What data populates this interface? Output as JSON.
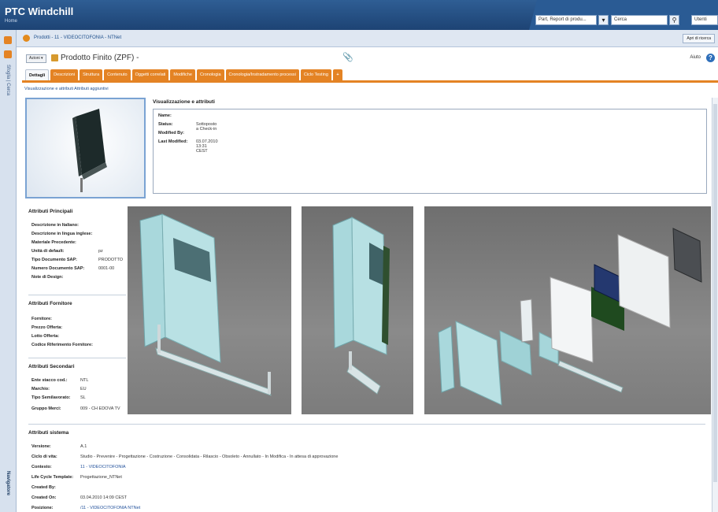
{
  "header": {
    "brand": "PTC Windchill",
    "brand_sub": "Home",
    "search_scope": "Part, Report di produ...",
    "search_placeholder": "Cerca",
    "user_button": "Utenti"
  },
  "breadcrumb": {
    "path": "Prodotti - 11 - VIDEOCITOFONIA - NTNet",
    "right_button": "Apri di ricerca"
  },
  "object": {
    "actions_label": "Azioni ▾",
    "title": "Prodotto Finito (ZPF) -",
    "help_label": "Aiuto",
    "help_icon": "help-icon"
  },
  "tabs": [
    {
      "label": "Dettagli",
      "active": true
    },
    {
      "label": "Descrizioni"
    },
    {
      "label": "Struttura"
    },
    {
      "label": "Contenuto"
    },
    {
      "label": "Oggetti correlati"
    },
    {
      "label": "Modifiche"
    },
    {
      "label": "Cronologia"
    },
    {
      "label": "Cronologia/Instradamento processi"
    },
    {
      "label": "Ciclo Testing"
    }
  ],
  "subnav": "Visualizzazione e attributi  Attributi aggiuntivi",
  "visualization": {
    "title": "Visualizzazione e attributi",
    "rows": [
      {
        "k": "Name:",
        "v": ""
      },
      {
        "k": "Status:",
        "v": "Sottoposto a Check-in"
      },
      {
        "k": "Modified By:",
        "v": ""
      },
      {
        "k": "Last Modified:",
        "v": "03.07.2010 13:31 CEST"
      }
    ]
  },
  "panels": {
    "principali": {
      "title": "Attributi Principali",
      "rows": [
        {
          "k": "Descrizione in Italiano:",
          "v": ""
        },
        {
          "k": "Descrizione in lingua inglese:",
          "v": ""
        },
        {
          "k": "Materiale Precedente:",
          "v": ""
        },
        {
          "k": "Unità di default:",
          "v": "pz"
        },
        {
          "k": "Tipo Documento SAP:",
          "v": "PRODOTTO"
        },
        {
          "k": "Numero Documento SAP:",
          "v": "0001-00"
        },
        {
          "k": "Note di Design:",
          "v": ""
        }
      ]
    },
    "fornitore": {
      "title": "Attributi Fornitore",
      "rows": [
        {
          "k": "Fornitore:",
          "v": ""
        },
        {
          "k": "Prezzo Offerta:",
          "v": ""
        },
        {
          "k": "Lotto Offerta:",
          "v": ""
        },
        {
          "k": "Codice Riferimento Fornitore:",
          "v": ""
        }
      ]
    },
    "secondari": {
      "title": "Attributi Secondari",
      "rows": [
        {
          "k": "Ente stacco cod.:",
          "v": "NTL"
        },
        {
          "k": "Marchio:",
          "v": "EU"
        },
        {
          "k": "Tipo Semilavorato:",
          "v": "SL"
        },
        {
          "k": "Gruppo Merci:",
          "v": "009 - CH EDOVA TV"
        }
      ]
    },
    "sistema": {
      "title": "Attributi sistema",
      "rows": [
        {
          "k": "Versione:",
          "v": "A.1"
        },
        {
          "k": "Ciclo di vita:",
          "v": "Studio - Prevenire - Progettazione - Costruzione - Consolidata - Rilascio - Obsoleto - Annullato - In Modifica - In attesa di approvazione",
          "link": false
        },
        {
          "k": "Contesto:",
          "v": "11 - VIDEOCITOFONIA",
          "link": true
        },
        {
          "k": "Life Cycle Template:",
          "v": "Progettazione_NTNet"
        },
        {
          "k": "Created By:",
          "v": ""
        },
        {
          "k": "Created On:",
          "v": "03.04.2010 14:09 CEST"
        },
        {
          "k": "Posizione:",
          "v": "/11 - VIDEOCITOFONIA NTNet",
          "link": true
        }
      ]
    }
  },
  "colors": {
    "header_blue": "#1d4374",
    "tab_orange": "#e48324",
    "link_blue": "#1f4f9a"
  }
}
